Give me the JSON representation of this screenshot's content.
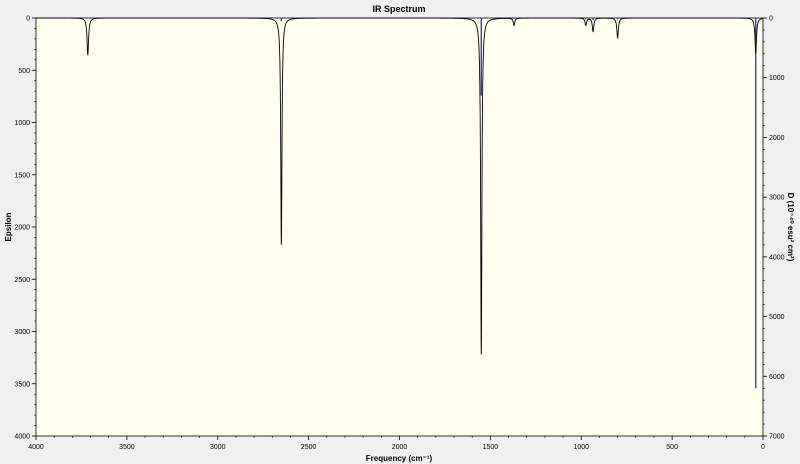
{
  "chart_data": {
    "type": "line",
    "title": "IR Spectrum",
    "xlabel": "Frequency (cm⁻¹)",
    "ylabel": "Epsilon",
    "y2label": "D (10⁻⁴⁰ esu² cm²)",
    "xlim": [
      4000,
      0
    ],
    "ylim": [
      0,
      4000
    ],
    "y2lim": [
      0,
      7000
    ],
    "y_inverted": true,
    "x_ticks": [
      "4000",
      "3500",
      "3000",
      "2500",
      "2000",
      "1500",
      "1000",
      "500",
      "0"
    ],
    "y_ticks": [
      "0",
      "500",
      "1000",
      "1500",
      "2000",
      "2500",
      "3000",
      "3500",
      "4000"
    ],
    "y2_ticks": [
      "0",
      "1000",
      "2000",
      "3000",
      "4000",
      "5000",
      "6000",
      "7000"
    ],
    "grid": false,
    "colors": {
      "background": "#ffffef",
      "spectrum": "#000000",
      "sticks": "#3c3cc8",
      "frame": "#f0f0f0"
    },
    "series": [
      {
        "type": "line",
        "peaks": [
          {
            "x": 3715,
            "y": 355,
            "hw": 5
          },
          {
            "x": 2650,
            "y": 2170,
            "hw": 4
          },
          {
            "x": 1550,
            "y": 3220,
            "hw": 4
          },
          {
            "x": 1370,
            "y": 70,
            "hw": 5
          },
          {
            "x": 975,
            "y": 70,
            "hw": 5
          },
          {
            "x": 935,
            "y": 130,
            "hw": 5
          },
          {
            "x": 800,
            "y": 190,
            "hw": 5
          },
          {
            "x": 40,
            "y": 330,
            "hw": 5
          }
        ]
      },
      {
        "type": "stick",
        "x": [
          3715,
          2650,
          1550,
          1370,
          975,
          935,
          800,
          40
        ],
        "y2": [
          10,
          55,
          1300,
          15,
          25,
          35,
          25,
          6200
        ]
      }
    ]
  }
}
